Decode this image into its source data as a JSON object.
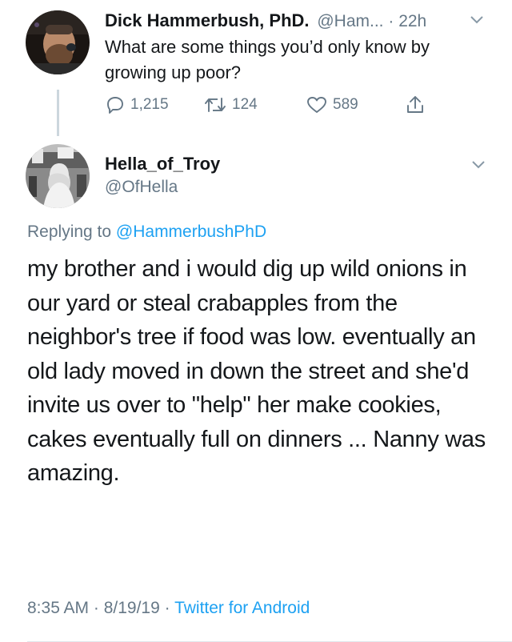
{
  "parent": {
    "display_name": "Dick Hammerbush, PhD.",
    "handle": "@Ham...",
    "separator": " · ",
    "time": "22h",
    "text": "What are some things you’d only know by growing up poor?",
    "replies": "1,215",
    "retweets": "124",
    "likes": "589",
    "icons": [
      "reply-icon",
      "retweet-icon",
      "like-icon",
      "share-icon",
      "chevron-down-icon"
    ]
  },
  "reply": {
    "display_name": "Hella_of_Troy",
    "handle": "@OfHella",
    "replying_prefix": "Replying to ",
    "replying_to": "@HammerbushPhD",
    "text": "my brother and i would dig up wild onions in our yard or steal crabapples from the neighbor's tree if food was low. eventually an old lady moved in down the street and she'd invite us over to \"help\" her make cookies, cakes eventually full on dinners ... Nanny was amazing.",
    "timestamp": "8:35 AM · 8/19/19 · ",
    "source": "Twitter for Android"
  },
  "colors": {
    "link": "#1da1f2",
    "muted": "#657786",
    "text": "#14171a"
  }
}
